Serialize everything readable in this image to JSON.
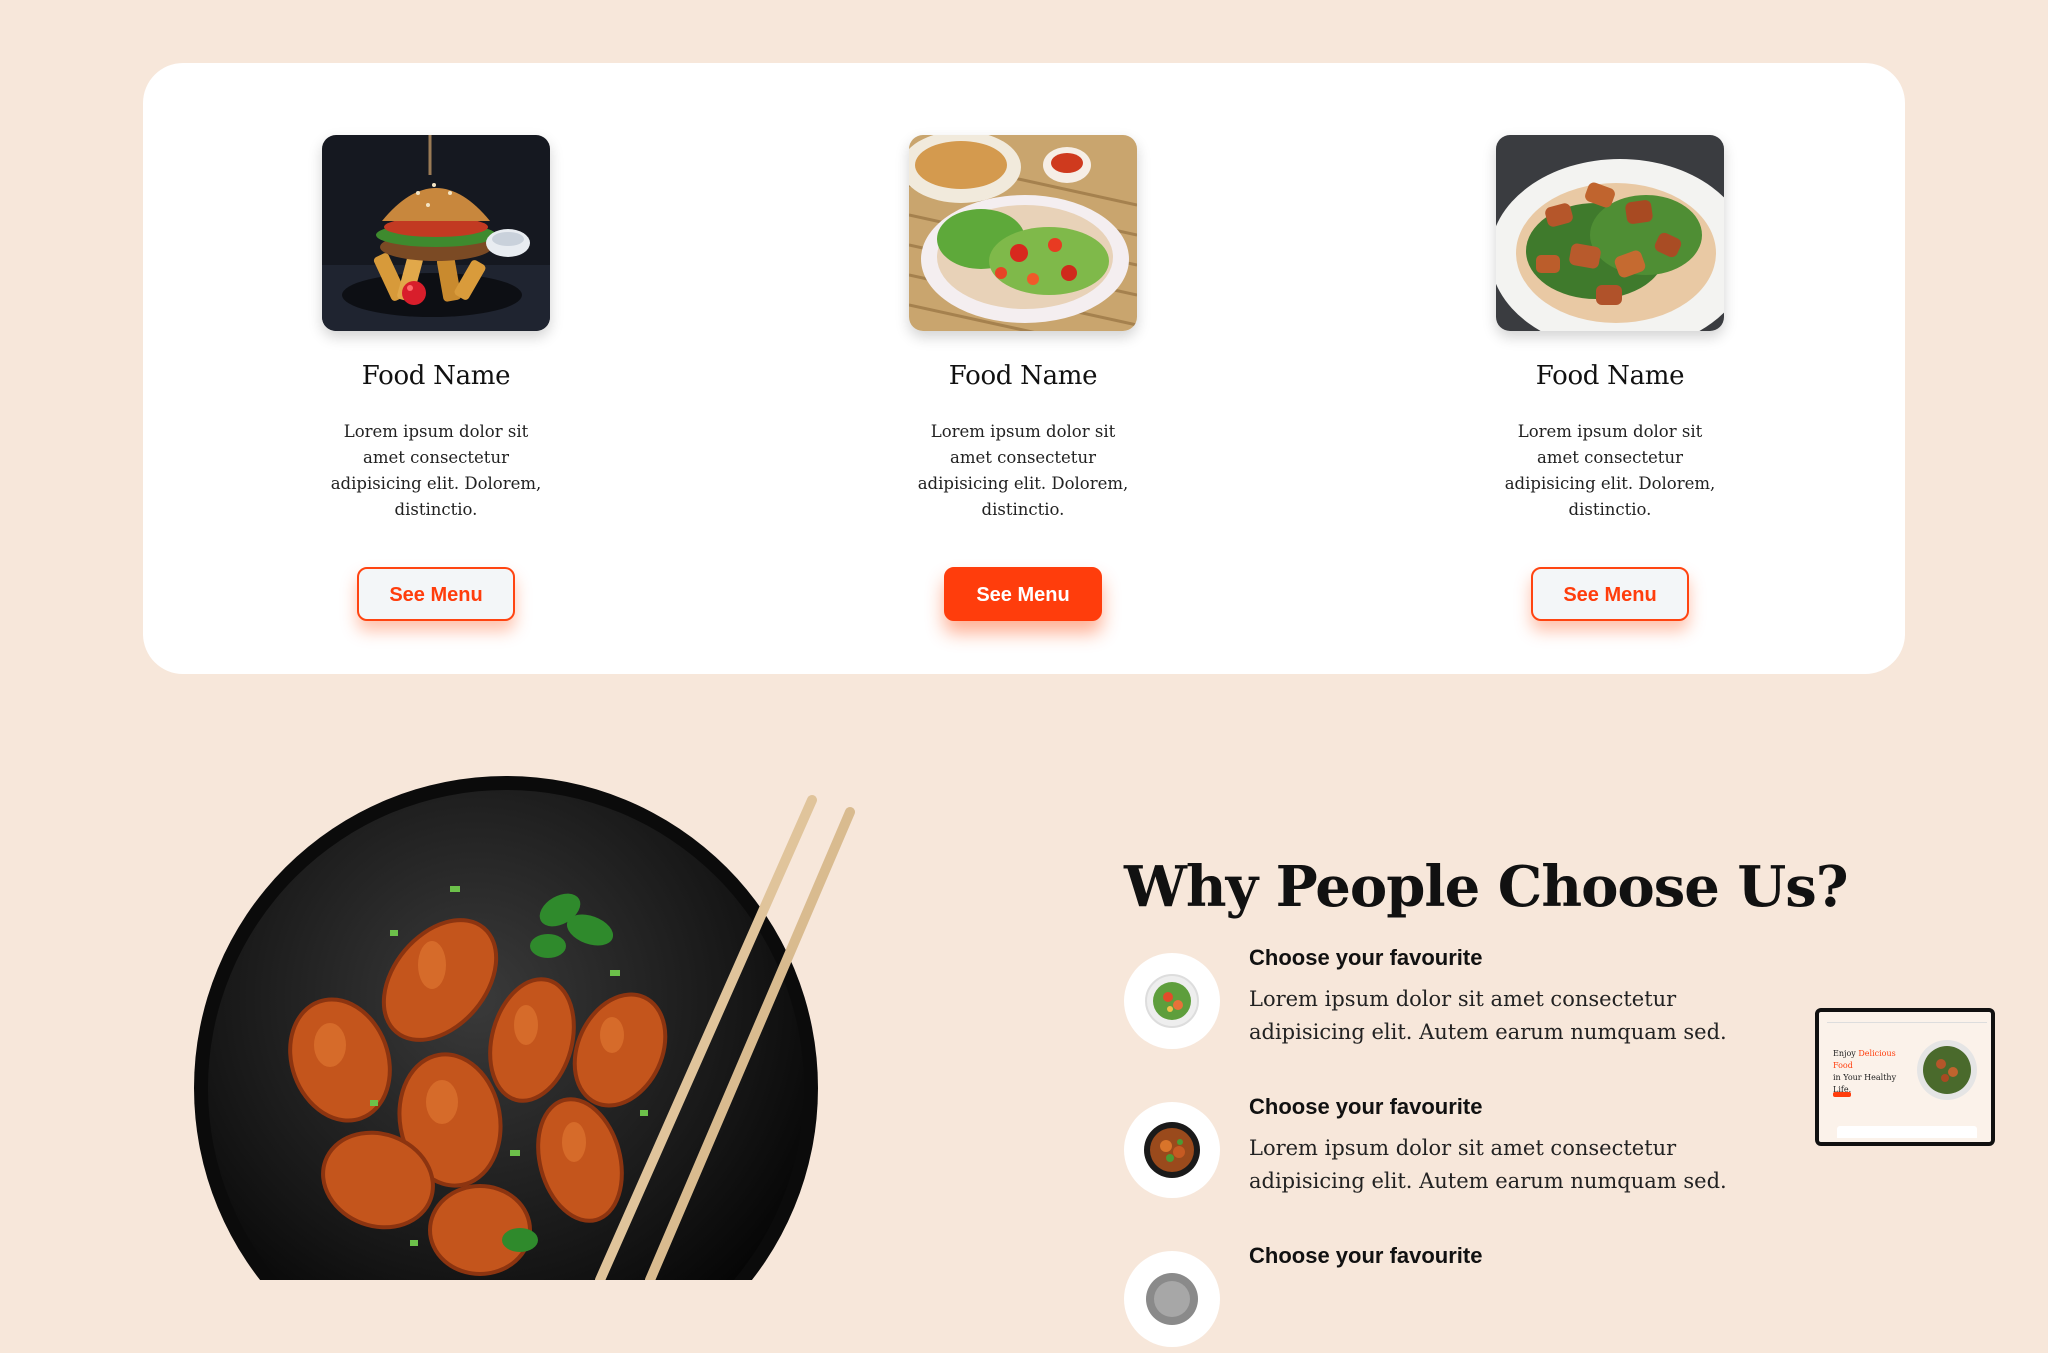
{
  "food_cards": [
    {
      "name": "Food Name",
      "description": "Lorem ipsum dolor sit amet consectetur adipisicing elit. Dolorem, distinctio.",
      "button_label": "See Menu",
      "button_style": "outline",
      "photo": "burger-and-fries"
    },
    {
      "name": "Food Name",
      "description": "Lorem ipsum dolor sit amet consectetur adipisicing elit. Dolorem, distinctio.",
      "button_label": "See Menu",
      "button_style": "solid",
      "photo": "papaya-salad-plate"
    },
    {
      "name": "Food Name",
      "description": "Lorem ipsum dolor sit amet consectetur adipisicing elit. Dolorem, distinctio.",
      "button_label": "See Menu",
      "button_style": "outline",
      "photo": "chicken-spinach-salad"
    }
  ],
  "why_section": {
    "title": "Why People Choose Us?",
    "features": [
      {
        "title": "Choose your favourite",
        "text": "Lorem ipsum dolor sit amet consectetur adipisicing elit. Autem earum numquam sed.",
        "icon": "salad-bowl-icon"
      },
      {
        "title": "Choose your favourite",
        "text": "Lorem ipsum dolor sit amet consectetur adipisicing elit. Autem earum numquam sed.",
        "icon": "noodle-bowl-icon"
      },
      {
        "title": "Choose your favourite",
        "icon": "dish-icon"
      }
    ]
  },
  "preview_thumbnail": {
    "hero_line1_prefix": "Enjoy",
    "hero_line1_accent": "Delicious Food",
    "hero_line2": "in Your Healthy Life."
  },
  "colors": {
    "page_background": "#f7e7da",
    "panel_background": "#ffffff",
    "accent": "#ff3d0c",
    "text": "#111111"
  }
}
